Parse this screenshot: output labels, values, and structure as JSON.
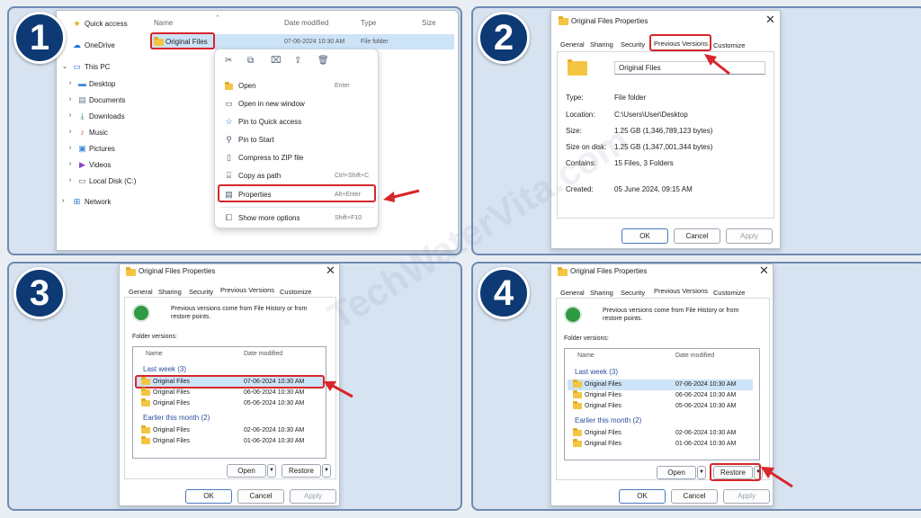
{
  "steps": [
    "1",
    "2",
    "3",
    "4"
  ],
  "watermark": "TechWaterVita.com",
  "explorer": {
    "nav": [
      "Quick access",
      "OneDrive",
      "This PC",
      "Desktop",
      "Documents",
      "Downloads",
      "Music",
      "Pictures",
      "Videos",
      "Local Disk (C:)",
      "Network"
    ],
    "columns": {
      "name": "Name",
      "date": "Date modified",
      "type": "Type",
      "size": "Size"
    },
    "row": {
      "name": "Original Files",
      "date": "07-06-2024 10:30 AM",
      "type": "File folder"
    },
    "menu": [
      {
        "label": "Open",
        "shortcut": "Enter"
      },
      {
        "label": "Open in new window",
        "shortcut": ""
      },
      {
        "label": "Pin to Quick access",
        "shortcut": ""
      },
      {
        "label": "Pin to Start",
        "shortcut": ""
      },
      {
        "label": "Compress to ZIP file",
        "shortcut": ""
      },
      {
        "label": "Copy as path",
        "shortcut": "Ctrl+Shift+C"
      },
      {
        "label": "Properties",
        "shortcut": "Alt+Enter"
      },
      {
        "label": "Show more options",
        "shortcut": "Shift+F10"
      }
    ]
  },
  "props": {
    "title": "Original Files Properties",
    "tabs": [
      "General",
      "Sharing",
      "Security",
      "Previous Versions",
      "Customize"
    ],
    "name_value": "Original Files",
    "fields": [
      {
        "label": "Type:",
        "value": "File folder"
      },
      {
        "label": "Location:",
        "value": "C:\\Users\\User\\Desktop"
      },
      {
        "label": "Size:",
        "value": "1.25 GB (1,346,789,123 bytes)"
      },
      {
        "label": "Size on disk:",
        "value": "1.25 GB (1,347,001,344 bytes)"
      },
      {
        "label": "Contains:",
        "value": "15 Files, 3 Folders"
      },
      {
        "label": "Created:",
        "value": "05 June 2024, 09:15 AM"
      }
    ],
    "ok": "OK",
    "cancel": "Cancel",
    "apply": "Apply"
  },
  "versions": {
    "intro": "Previous versions come from File History or from restore points.",
    "folder_versions": "Folder versions:",
    "col_name": "Name",
    "col_date": "Date modified",
    "groups": [
      {
        "label": "Last week (3)",
        "items": [
          {
            "name": "Original Files",
            "date": "07-06-2024 10:30 AM"
          },
          {
            "name": "Original Files",
            "date": "06-06-2024 10:30 AM"
          },
          {
            "name": "Original Files",
            "date": "05-06-2024 10:30 AM"
          }
        ]
      },
      {
        "label": "Earlier this month (2)",
        "items": [
          {
            "name": "Original Files",
            "date": "02-06-2024 10:30 AM"
          },
          {
            "name": "Original Files",
            "date": "01-06-2024 10:30 AM"
          }
        ]
      }
    ],
    "open": "Open",
    "restore": "Restore"
  }
}
